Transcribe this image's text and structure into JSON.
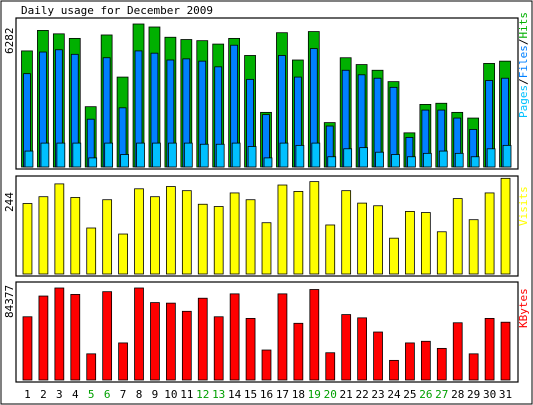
{
  "title": "Daily usage for December 2009",
  "colors": {
    "background": "#ffffff",
    "frame": "#000000",
    "hits": "#00b000",
    "files": "#0080ff",
    "pages": "#00c0ff",
    "visits": "#ffff00",
    "kbytes": "#ff0000",
    "weekend_label": "#00a000",
    "weekday_label": "#000000"
  },
  "days": [
    "1",
    "2",
    "3",
    "4",
    "5",
    "6",
    "7",
    "8",
    "9",
    "10",
    "11",
    "12",
    "13",
    "14",
    "15",
    "16",
    "17",
    "18",
    "19",
    "20",
    "21",
    "22",
    "23",
    "24",
    "25",
    "26",
    "27",
    "28",
    "29",
    "30",
    "31"
  ],
  "weekend_days": [
    "5",
    "6",
    "12",
    "13",
    "19",
    "20",
    "26",
    "27"
  ],
  "chart_data": [
    {
      "type": "bar",
      "panel": "hits-files-pages",
      "ylabel_max": "6282",
      "legend": {
        "pages": "Pages",
        "files": "Files",
        "hits": "Hits",
        "sep": "/"
      },
      "ylim": [
        0,
        6282
      ],
      "categories": [
        "1",
        "2",
        "3",
        "4",
        "5",
        "6",
        "7",
        "8",
        "9",
        "10",
        "11",
        "12",
        "13",
        "14",
        "15",
        "16",
        "17",
        "18",
        "19",
        "20",
        "21",
        "22",
        "23",
        "24",
        "25",
        "26",
        "27",
        "28",
        "29",
        "30",
        "31"
      ],
      "series": [
        {
          "name": "Hits",
          "values": [
            5100,
            6000,
            5850,
            5650,
            2650,
            5800,
            3950,
            6282,
            6150,
            5700,
            5600,
            5550,
            5400,
            5650,
            4900,
            2400,
            5900,
            4700,
            5950,
            1950,
            4800,
            4500,
            4250,
            3750,
            1500,
            2750,
            2800,
            2400,
            2150,
            4550,
            4650
          ]
        },
        {
          "name": "Files",
          "values": [
            4100,
            5050,
            5150,
            4950,
            2100,
            4800,
            2600,
            5100,
            5000,
            4700,
            4750,
            4650,
            4400,
            5350,
            3850,
            2300,
            4900,
            3950,
            5200,
            1800,
            4250,
            4050,
            3900,
            3500,
            1300,
            2500,
            2500,
            2150,
            1650,
            3800,
            3900
          ]
        },
        {
          "name": "Pages",
          "values": [
            700,
            1050,
            1050,
            1050,
            400,
            1050,
            550,
            1050,
            1050,
            1050,
            1050,
            1000,
            1000,
            1050,
            900,
            400,
            1050,
            950,
            1050,
            450,
            800,
            850,
            650,
            550,
            450,
            600,
            700,
            600,
            450,
            800,
            950
          ]
        }
      ]
    },
    {
      "type": "bar",
      "panel": "visits",
      "ylabel_max": "244",
      "legend": {
        "visits": "Visits"
      },
      "ylim": [
        0,
        244
      ],
      "categories": [
        "1",
        "2",
        "3",
        "4",
        "5",
        "6",
        "7",
        "8",
        "9",
        "10",
        "11",
        "12",
        "13",
        "14",
        "15",
        "16",
        "17",
        "18",
        "19",
        "20",
        "21",
        "22",
        "23",
        "24",
        "25",
        "26",
        "27",
        "28",
        "29",
        "30",
        "31"
      ],
      "series": [
        {
          "name": "Visits",
          "values": [
            187,
            205,
            239,
            203,
            122,
            197,
            106,
            226,
            205,
            232,
            221,
            185,
            179,
            215,
            197,
            136,
            236,
            219,
            245,
            130,
            221,
            188,
            181,
            95,
            166,
            163,
            112,
            200,
            144,
            215,
            260
          ]
        }
      ]
    },
    {
      "type": "bar",
      "panel": "kbytes",
      "ylabel_max": "84377",
      "legend": {
        "kbytes": "KBytes"
      },
      "ylim": [
        0,
        84377
      ],
      "categories": [
        "1",
        "2",
        "3",
        "4",
        "5",
        "6",
        "7",
        "8",
        "9",
        "10",
        "11",
        "12",
        "13",
        "14",
        "15",
        "16",
        "17",
        "18",
        "19",
        "20",
        "21",
        "22",
        "23",
        "24",
        "25",
        "26",
        "27",
        "28",
        "29",
        "30",
        "31"
      ],
      "series": [
        {
          "name": "KBytes",
          "values": [
            58000,
            77000,
            84377,
            78500,
            24000,
            81000,
            34000,
            84377,
            71000,
            70500,
            63000,
            75000,
            58000,
            79000,
            56500,
            27500,
            79000,
            52000,
            83000,
            25000,
            60000,
            57000,
            44000,
            18000,
            34000,
            35500,
            29000,
            52500,
            24000,
            56500,
            53000
          ]
        }
      ]
    }
  ]
}
